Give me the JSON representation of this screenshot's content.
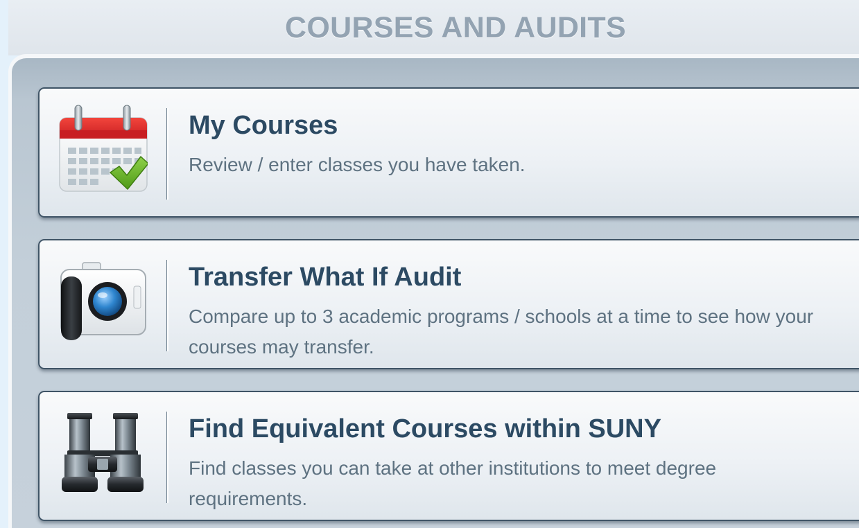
{
  "header": {
    "title": "COURSES AND AUDITS"
  },
  "menu": {
    "items": [
      {
        "title": "My Courses",
        "description": "Review / enter classes you have taken.",
        "icon": "calendar-check-icon"
      },
      {
        "title": "Transfer What If Audit",
        "description": "Compare up to 3 academic programs / schools at a time to see how your courses may transfer.",
        "icon": "camera-icon"
      },
      {
        "title": "Find Equivalent Courses within SUNY",
        "description": "Find classes you can take at other institutions to meet degree requirements.",
        "icon": "binoculars-icon"
      }
    ]
  },
  "colors": {
    "title_text": "#2c4a63",
    "description_text": "#5e7281",
    "header_text": "#93a3b2",
    "card_border": "#3f5466",
    "calendar_red": "#d9282b",
    "check_green": "#6ab324",
    "lens_blue": "#2f86cf"
  }
}
